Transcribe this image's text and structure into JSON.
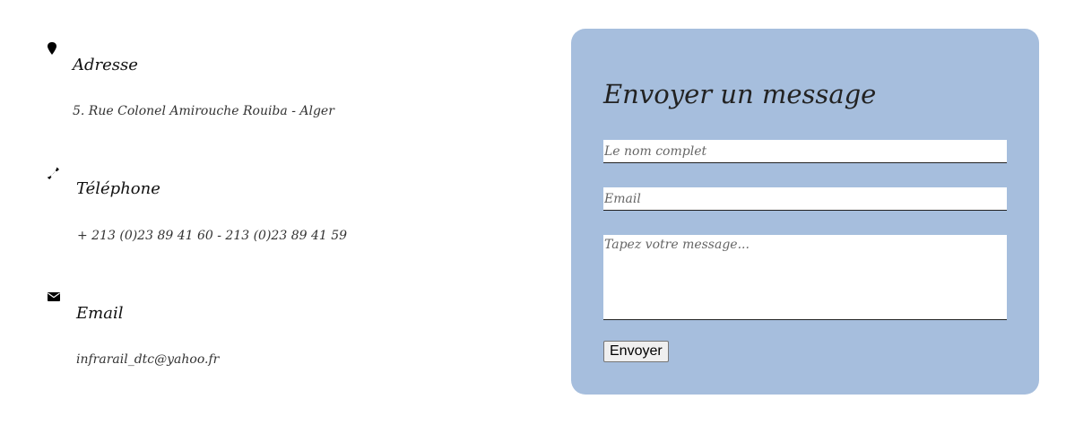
{
  "contact": {
    "address": {
      "icon": "map-marker-icon",
      "title": "Adresse",
      "value": "5. Rue Colonel Amirouche Rouiba - Alger"
    },
    "phone": {
      "icon": "phone-icon",
      "title": "Téléphone",
      "value": "+ 213 (0)23 89 41 60 - 213 (0)23 89 41 59"
    },
    "email": {
      "icon": "envelope-icon",
      "title": "Email",
      "value": "infrarail_dtc@yahoo.fr"
    }
  },
  "form": {
    "title": "Envoyer un message",
    "name_placeholder": "Le nom complet",
    "email_placeholder": "Email",
    "message_placeholder": "Tapez votre message...",
    "submit_label": "Envoyer",
    "panel_color": "#a6bedd"
  }
}
